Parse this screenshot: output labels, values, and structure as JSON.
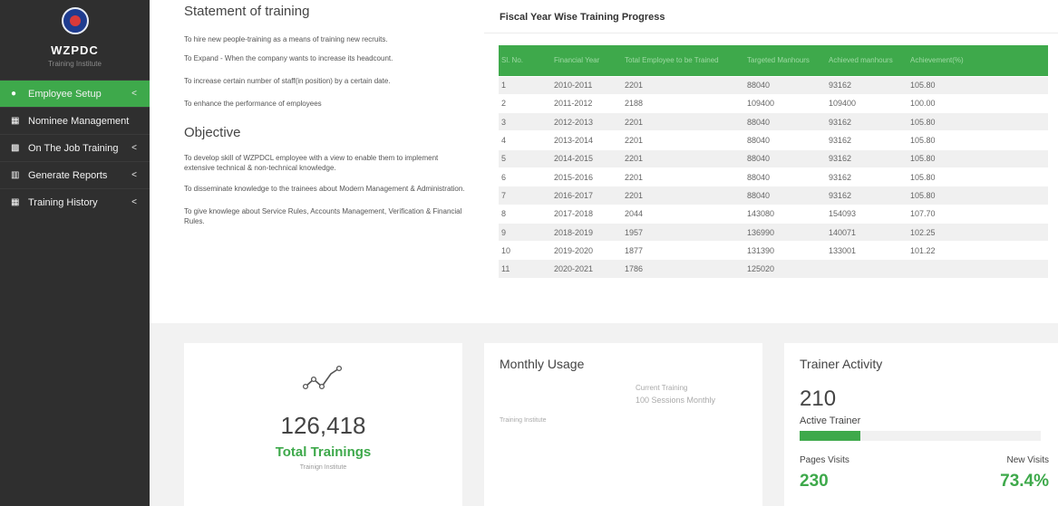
{
  "sidebar": {
    "brand_name": "WZPDC",
    "brand_sub": "Training Institute",
    "items": [
      {
        "label": "Employee Setup",
        "icon": "user-icon"
      },
      {
        "label": "Nominee Management",
        "icon": "id-card-icon"
      },
      {
        "label": "On The Job Training",
        "icon": "book-icon"
      },
      {
        "label": "Generate Reports",
        "icon": "bar-chart-icon"
      },
      {
        "label": "Training History",
        "icon": "table-icon"
      }
    ],
    "chevron": "<"
  },
  "statement": {
    "title": "Statement of training",
    "points": [
      "To hire new people-training as a means of training new recruits.",
      "To Expand - When the company wants to increase its headcount.",
      "To increase certain number of staff(in position) by a certain date.",
      "To enhance the performance of employees"
    ]
  },
  "objective": {
    "title": "Objective",
    "points": [
      "To develop skill of WZPDCL employee with a view to enable them to implement extensive technical & non-technical knowledge.",
      "To disseminate knowledge to the trainees about Modern Management & Administration.",
      "To give knowlege about Service Rules, Accounts Management, Verification & Financial Rules."
    ]
  },
  "table": {
    "title": "Fiscal Year Wise Training Progress",
    "headers": [
      "Sl. No.",
      "Financial Year",
      "Total Employee to be Trained",
      "Targeted Manhours",
      "Achieved manhours",
      "Achievement(%)"
    ],
    "rows": [
      [
        "1",
        "2010-2011",
        "2201",
        "88040",
        "93162",
        "105.80"
      ],
      [
        "2",
        "2011-2012",
        "2188",
        "109400",
        "109400",
        "100.00"
      ],
      [
        "3",
        "2012-2013",
        "2201",
        "88040",
        "93162",
        "105.80"
      ],
      [
        "4",
        "2013-2014",
        "2201",
        "88040",
        "93162",
        "105.80"
      ],
      [
        "5",
        "2014-2015",
        "2201",
        "88040",
        "93162",
        "105.80"
      ],
      [
        "6",
        "2015-2016",
        "2201",
        "88040",
        "93162",
        "105.80"
      ],
      [
        "7",
        "2016-2017",
        "2201",
        "88040",
        "93162",
        "105.80"
      ],
      [
        "8",
        "2017-2018",
        "2044",
        "143080",
        "154093",
        "107.70"
      ],
      [
        "9",
        "2018-2019",
        "1957",
        "136990",
        "140071",
        "102.25"
      ],
      [
        "10",
        "2019-2020",
        "1877",
        "131390",
        "133001",
        "101.22"
      ],
      [
        "11",
        "2020-2021",
        "1786",
        "125020",
        "",
        ""
      ]
    ]
  },
  "total_card": {
    "icon": "trend-line-icon",
    "value": "126,418",
    "label": "Total Trainings",
    "sub": "Trainign Institute"
  },
  "monthly_card": {
    "title": "Monthly Usage",
    "current_label": "Current Training",
    "current_value": "100 Sessions Monthly",
    "institute": "Training Institute"
  },
  "trainer_card": {
    "title": "Trainer Activity",
    "active_count": "210",
    "active_label": "Active Trainer",
    "progress": 0.25,
    "pages_label": "Pages Visits",
    "pages_value": "230",
    "new_label": "New Visits",
    "new_value": "73.4%"
  },
  "colors": {
    "accent": "#3ea94b",
    "sidebar_bg": "#2f2f2f"
  }
}
